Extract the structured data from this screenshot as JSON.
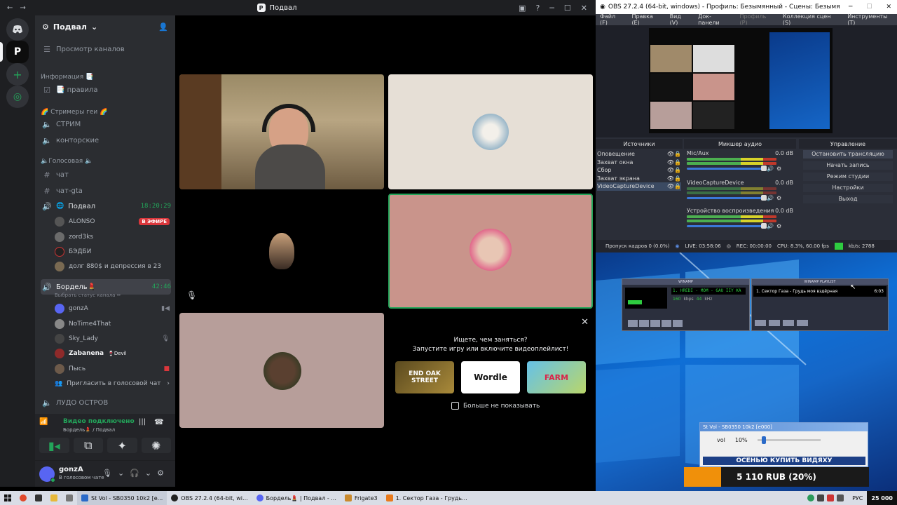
{
  "discord": {
    "window_title": "Подвал",
    "server": {
      "name": "Подвал"
    },
    "browse_channels": "Просмотр каналов",
    "categories": {
      "info": "Информация 📑",
      "streamers": "🌈 Стримеры геи 🌈",
      "voice": "🔈Голосовая 🔈"
    },
    "channels": {
      "rules": "📑 правила",
      "stream": "СТРИМ",
      "contorskie": "конторские",
      "chat": "чат",
      "chat_gta": "чат-gta",
      "podval": "Подвал",
      "bordel": "Бордель💄",
      "ludo": "ЛУДО ОСТРОВ"
    },
    "podval_time": "18:20:29",
    "bordel_time": "42:46",
    "bordel_status_hint": "Выбрать статус канала ✏",
    "podval_users": [
      {
        "name": "ALONSO",
        "badge": "В ЭФИРЕ"
      },
      {
        "name": "zord3ks"
      },
      {
        "name": "БЭДБИ"
      },
      {
        "name": "долг 880$ и депрессия в 23"
      }
    ],
    "bordel_users": [
      {
        "name": "gonzA"
      },
      {
        "name": "NoTime4That"
      },
      {
        "name": "Sky_Lady"
      },
      {
        "name": "Zabanena",
        "tag": "🍷Devil"
      },
      {
        "name": "Пысь"
      }
    ],
    "invite_voice": "Пригласить в голосовой чат",
    "voice_connected": "Видео подключено",
    "voice_channel_path": "Бордель💄 / Подвал",
    "user": {
      "name": "gonzA",
      "status": "В голосовом чате"
    },
    "activity": {
      "title": "Ищете, чем заняться?",
      "subtitle": "Запустите игру или включите видеоплейлист!",
      "games": [
        "END OAK STREET",
        "Wordle",
        "FARM"
      ],
      "dont_show": "Больше не показывать"
    }
  },
  "obs": {
    "title": "OBS 27.2.4 (64-bit, windows) - Профиль: Безымянный - Сцены: Безымянный",
    "menu": [
      "Файл (F)",
      "Правка (E)",
      "Вид (V)",
      "Док-панели",
      "Профиль (P)",
      "Коллекция сцен (S)",
      "Инструменты (T)"
    ],
    "sources_title": "Источники",
    "sources": [
      "Оповещение",
      "Захват окна",
      "Сбор",
      "Захват экрана",
      "VideoCaptureDevice"
    ],
    "mixer_title": "Микшер аудио",
    "mixer": [
      {
        "name": "Mic/Aux",
        "db": "0.0 dB"
      },
      {
        "name": "VideoCaptureDevice",
        "db": "0.0 dB"
      },
      {
        "name": "Устройство воспроизведения",
        "db": "0.0 dB"
      }
    ],
    "controls_title": "Управление",
    "controls": [
      "Остановить трансляцию",
      "Начать запись",
      "Режим студии",
      "Настройки",
      "Выход"
    ],
    "status": {
      "dropped": "Пропуск кадров 0 (0.0%)",
      "live": "LIVE: 03:58:06",
      "rec": "REC: 00:00:00",
      "cpu": "CPU: 8.3%, 60.00 fps",
      "kbps": "kb/s: 2788"
    }
  },
  "winamp": {
    "title": "WINAMP",
    "playlist_title": "WINAMP PLAYLIST",
    "track": "1. Сектор Газа - Грудь моя вздёрная",
    "track_time": "6:03",
    "kbps": "160",
    "khz": "44",
    "display_text": "1. HREDI - MOM - GAU IIY KA"
  },
  "stvol": {
    "title": "St Vol - SB0350 10k2 [e000]",
    "label": "vol",
    "value": "10%",
    "level": 0.1
  },
  "donation": {
    "banner": "ОСЕНЬЮ КУПИТЬ ВИДЯХУ",
    "amount": "5 110 RUB (20%)",
    "progress": 0.2
  },
  "taskbar": {
    "items": [
      "St Vol - SB0350 10k2 [e...",
      "OBS 27.2.4 (64-bit, wi...",
      "Бордель💄 | Подвал - ...",
      "Frigate3",
      "1. Сектор Газа - Грудь..."
    ],
    "lang": "РУС",
    "clock": "25 000"
  },
  "colors": {
    "accent_green": "#23a55a",
    "live_red": "#da373c",
    "tile_beige": "#e6dfd6",
    "tile_pink": "#c9948b",
    "tile_dark": "#232428",
    "tile_mauve": "#b79e9a",
    "donate_orange": "#f0900a"
  }
}
